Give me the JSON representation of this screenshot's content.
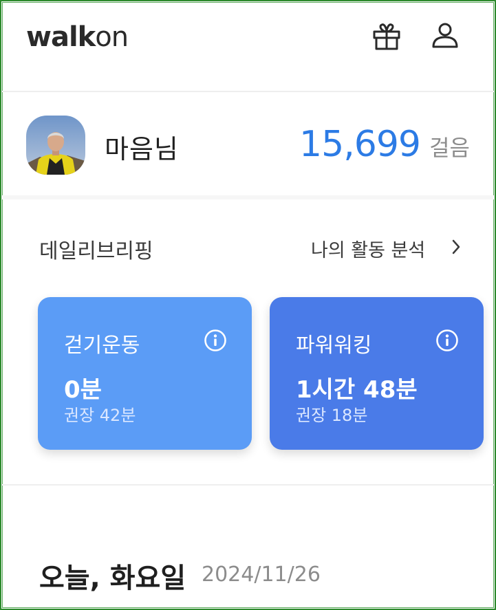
{
  "header": {
    "logo_bold": "walk",
    "logo_light": "on",
    "gift_icon": "gift-icon",
    "profile_icon": "person-icon"
  },
  "profile": {
    "name": "마음님",
    "steps": "15,699",
    "steps_unit": "걸음"
  },
  "briefing": {
    "title": "데일리브리핑",
    "link_label": "나의 활동 분석",
    "cards": [
      {
        "title": "걷기운동",
        "value": "0분",
        "recommend": "권장 42분",
        "color": "#5b9cf6"
      },
      {
        "title": "파워워킹",
        "value": "1시간 48분",
        "recommend": "권장 18분",
        "color": "#4a7be8"
      }
    ]
  },
  "today": {
    "label": "오늘, 화요일",
    "date": "2024/11/26"
  },
  "colors": {
    "accent": "#2c7be5",
    "frame": "#2d8a2d"
  }
}
